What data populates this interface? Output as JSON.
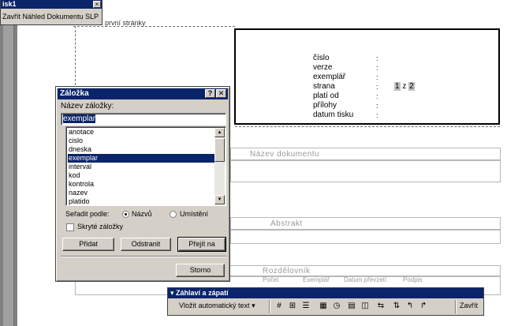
{
  "preview_toolbar": {
    "title": "isk1",
    "close_glyph": "×",
    "button_label": "Zavřít Náhled Dokumentu SLP"
  },
  "document": {
    "first_page_header_label": "í první stránky",
    "info_labels": [
      "číslo",
      "verze",
      "exemplář",
      "strana",
      "platí od",
      "přílohy",
      "datum tisku"
    ],
    "info_colons": [
      ":",
      ":",
      ":",
      ":",
      ":",
      ":",
      ":"
    ],
    "page_current": "1",
    "page_of": "z",
    "page_total": "2",
    "sections": {
      "document_name": "Název dokumentu",
      "abstract": "Abstrakt",
      "distribution": "Rozdělovník"
    },
    "distribution_columns": [
      "Počet",
      "Exemplář",
      "Datum převzetí",
      "Podpis"
    ]
  },
  "dialog": {
    "title": "Záložka",
    "help_glyph": "?",
    "close_glyph": "✕",
    "name_label": "Název záložky:",
    "name_value": "exemplar",
    "bookmarks": [
      "anotace",
      "cislo",
      "dneska",
      "exemplar",
      "interval",
      "kod",
      "kontrola",
      "nazev",
      "platido"
    ],
    "selected_index": 3,
    "sort_label": "Seřadit podle:",
    "sort_options": [
      "Názvů",
      "Umístění"
    ],
    "sort_selected": 0,
    "hidden_label": "Skryté záložky",
    "hidden_checked": false,
    "buttons": {
      "add": "Přidat",
      "delete": "Odstranit",
      "goto": "Přejít na",
      "cancel": "Storno"
    }
  },
  "header_footer_toolbar": {
    "title": "Záhlaví a zápatí",
    "title_glyph": "▾",
    "insert_autotext": "Vložit automatický text",
    "insert_arrow": "▾",
    "close": "Zavřít",
    "icons": [
      "page-number-icon",
      "page-count-icon",
      "format-page-number-icon",
      "date-icon",
      "time-icon",
      "page-setup-icon",
      "show-text-icon",
      "same-as-previous-icon",
      "switch-header-footer-icon",
      "previous-icon",
      "next-icon"
    ]
  },
  "colors": {
    "title_bar": "#0a246a",
    "dialog_face": "#d4d0c8",
    "section_title": "#9a9a9a"
  }
}
